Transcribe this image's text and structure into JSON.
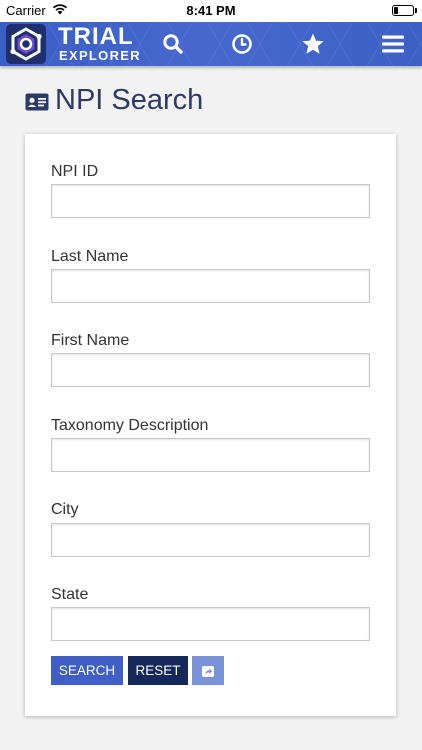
{
  "status_bar": {
    "carrier": "Carrier",
    "time": "8:41 PM",
    "wifi_icon": "wifi-icon",
    "battery_icon": "battery-icon",
    "battery_level": 0.25
  },
  "navbar": {
    "brand_line1": "TRIAL",
    "brand_line2": "EXPLORER",
    "icons": [
      "search-icon",
      "clock-icon",
      "star-icon",
      "menu-icon"
    ],
    "color": "#3b5fc7"
  },
  "page": {
    "title": "NPI Search",
    "title_icon": "id-card-icon"
  },
  "form": {
    "fields": [
      {
        "label": "NPI ID",
        "value": "",
        "placeholder": ""
      },
      {
        "label": "Last Name",
        "value": "",
        "placeholder": ""
      },
      {
        "label": "First Name",
        "value": "",
        "placeholder": ""
      },
      {
        "label": "Taxonomy Description",
        "value": "",
        "placeholder": ""
      },
      {
        "label": "City",
        "value": "",
        "placeholder": ""
      },
      {
        "label": "State",
        "value": "",
        "placeholder": ""
      }
    ],
    "buttons": {
      "search": "SEARCH",
      "reset": "RESET",
      "share_icon": "share-icon"
    },
    "colors": {
      "search": "#3f5fc7",
      "reset": "#14285c",
      "share": "#7a93d9"
    }
  }
}
